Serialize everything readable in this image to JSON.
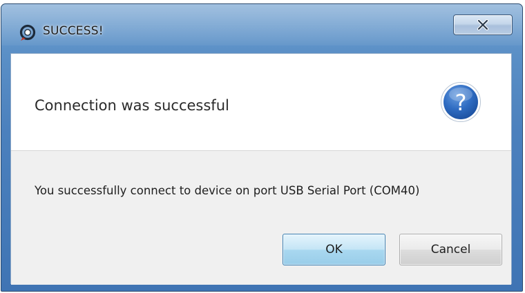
{
  "window": {
    "title": "SUCCESS!",
    "icon": "app-logo-icon",
    "close_glyph": "x"
  },
  "dialog": {
    "header": "Connection was successful",
    "header_icon": "question-icon",
    "message": "You successfully connect to device on port USB Serial Port (COM40)"
  },
  "buttons": {
    "ok_label": "OK",
    "cancel_label": "Cancel"
  },
  "colors": {
    "titlebar": "#4b80bd",
    "question_icon": "#2a62b4",
    "ok_button": "#a9d8f0"
  }
}
